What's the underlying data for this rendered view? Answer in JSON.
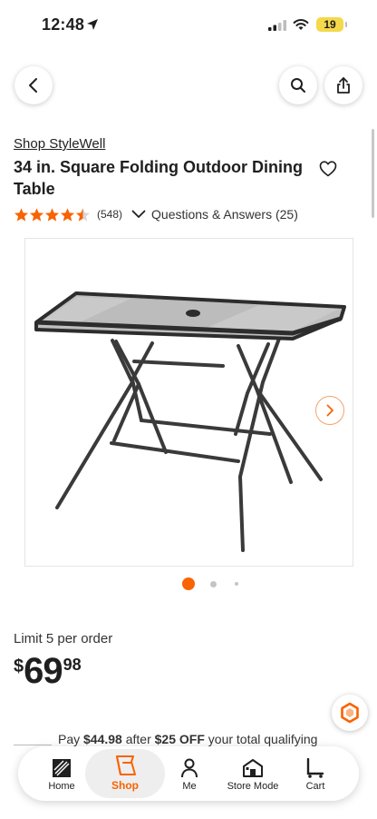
{
  "status_bar": {
    "time": "12:48",
    "battery": "19"
  },
  "product": {
    "brand_link": "Shop StyleWell",
    "title": "34 in. Square Folding Outdoor Dining Table",
    "rating": 4.5,
    "review_count": "(548)",
    "qa_label": "Questions & Answers (25)"
  },
  "gallery": {
    "image_alt": "Square folding outdoor dining table",
    "dot_count": 3,
    "active_dot": 0
  },
  "pricing": {
    "limit_text": "Limit 5 per order",
    "currency": "$",
    "dollars": "69",
    "cents": "98"
  },
  "promo": {
    "prefix": "Pay",
    "amount": "$44.98",
    "middle": "after",
    "discount": "$25 OFF",
    "suffix": "your total qualifying"
  },
  "tabbar": {
    "items": [
      {
        "label": "Home"
      },
      {
        "label": "Shop"
      },
      {
        "label": "Me"
      },
      {
        "label": "Store Mode"
      },
      {
        "label": "Cart"
      }
    ],
    "active_index": 1
  },
  "colors": {
    "accent": "#f96302",
    "star": "#f96302"
  }
}
